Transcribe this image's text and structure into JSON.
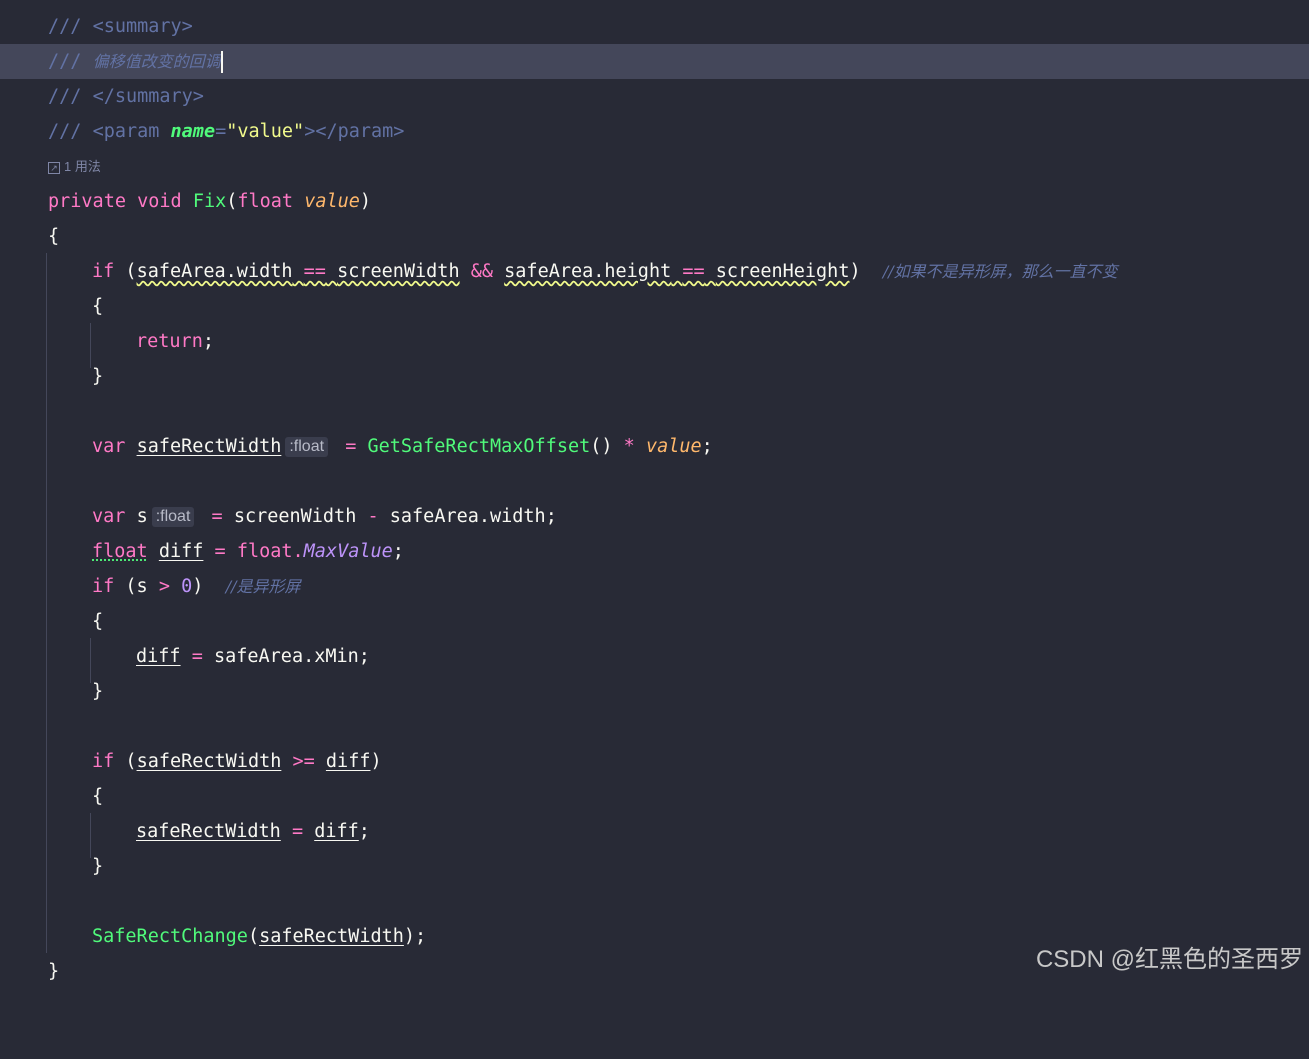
{
  "usage_hint": {
    "icon": "external-link-icon",
    "label": "1 用法"
  },
  "summary_open": {
    "slashes": "///",
    "tag": "<summary>"
  },
  "summary_text": {
    "slashes": "///",
    "text": "偏移值改变的回调"
  },
  "summary_close": {
    "slashes": "///",
    "tag": "</summary>"
  },
  "param_doc": {
    "slashes": "///",
    "open": "<param",
    "attr": "name",
    "eq": "=",
    "value": "\"value\"",
    "close": "></param>"
  },
  "signature": {
    "private": "private",
    "void": "void",
    "name": "Fix",
    "lparen": "(",
    "type": "float",
    "param": "value",
    "rparen": ")"
  },
  "open_brace": "{",
  "close_brace": "}",
  "if1": {
    "if": "if",
    "lparen": "(",
    "left": "safeArea.width",
    "eq1": "==",
    "sw": "screenWidth",
    "and": "&&",
    "left2": "safeArea.height",
    "eq2": "==",
    "sh": "screenHeight",
    "rparen": ")",
    "comment": "//如果不是异形屏，那么一直不变"
  },
  "return_stmt": {
    "kw": "return",
    "semi": ";"
  },
  "var1": {
    "var": "var",
    "name": "safeRectWidth",
    "hint": ":float",
    "eq": "=",
    "call": "GetSafeRectMaxOffset",
    "paren": "()",
    "mul": "*",
    "param": "value",
    "semi": ";"
  },
  "var2": {
    "var": "var",
    "name": "s",
    "hint": ":float",
    "eq": "=",
    "lhs": "screenWidth",
    "minus": "-",
    "rhs": "safeArea.width;"
  },
  "float_decl": {
    "type": "float",
    "name": "diff",
    "eq": "=",
    "obj": "float.",
    "prop": "MaxValue",
    "semi": ";"
  },
  "if2": {
    "if": "if",
    "lparen": "(s",
    "gt": ">",
    "zero": "0",
    "rparen": ")",
    "comment": "//是异形屏"
  },
  "diff_assign": {
    "name": "diff",
    "eq": "=",
    "rhs": "safeArea.xMin;"
  },
  "if3": {
    "if": "if",
    "lparen": "(",
    "left": "safeRectWidth",
    "ge": ">=",
    "right": "diff",
    "rparen": ")"
  },
  "srw_assign": {
    "name": "safeRectWidth",
    "eq": "=",
    "rhs": "diff",
    "semi": ";"
  },
  "change_call": {
    "fn": "SafeRectChange",
    "lparen": "(",
    "arg": "safeRectWidth",
    "rparen": ");"
  },
  "watermark": "CSDN @红黑色的圣西罗",
  "colors": {
    "background": "#282a36",
    "current_line": "#44475a",
    "keyword": "#ff79c6",
    "function": "#50fa7b",
    "comment": "#6272a4",
    "parameter": "#ffb86c"
  }
}
